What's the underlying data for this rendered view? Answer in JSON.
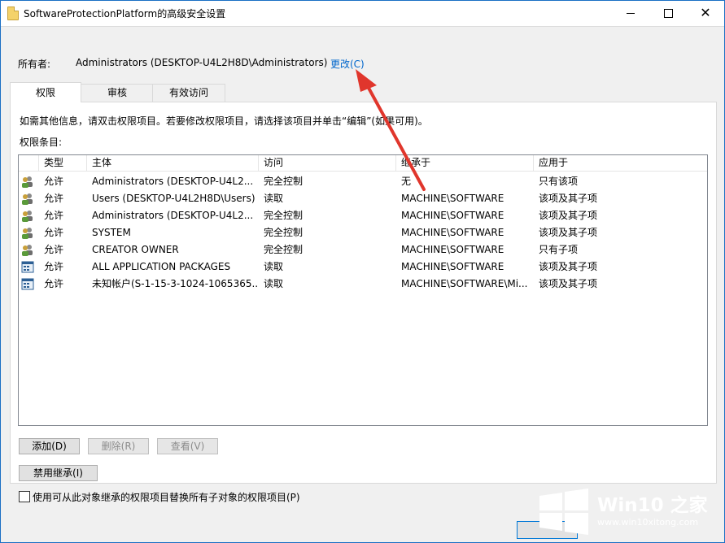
{
  "window": {
    "title": "SoftwareProtectionPlatform的高级安全设置"
  },
  "owner": {
    "label": "所有者:",
    "value": "Administrators (DESKTOP-U4L2H8D\\Administrators)",
    "change_link": "更改(C)"
  },
  "tabs": [
    {
      "label": "权限"
    },
    {
      "label": "审核"
    },
    {
      "label": "有效访问"
    }
  ],
  "info_text": "如需其他信息，请双击权限项目。若要修改权限项目，请选择该项目并单击“编辑”(如果可用)。",
  "entries_label": "权限条目:",
  "columns": [
    "类型",
    "主体",
    "访问",
    "继承于",
    "应用于"
  ],
  "rows": [
    {
      "icon": "users-icon",
      "type": "允许",
      "principal": "Administrators (DESKTOP-U4L2...",
      "access": "完全控制",
      "inherited": "无",
      "applies": "只有该项"
    },
    {
      "icon": "users-icon",
      "type": "允许",
      "principal": "Users (DESKTOP-U4L2H8D\\Users)",
      "access": "读取",
      "inherited": "MACHINE\\SOFTWARE",
      "applies": "该项及其子项"
    },
    {
      "icon": "users-icon",
      "type": "允许",
      "principal": "Administrators (DESKTOP-U4L2...",
      "access": "完全控制",
      "inherited": "MACHINE\\SOFTWARE",
      "applies": "该项及其子项"
    },
    {
      "icon": "users-icon",
      "type": "允许",
      "principal": "SYSTEM",
      "access": "完全控制",
      "inherited": "MACHINE\\SOFTWARE",
      "applies": "该项及其子项"
    },
    {
      "icon": "users-icon",
      "type": "允许",
      "principal": "CREATOR OWNER",
      "access": "完全控制",
      "inherited": "MACHINE\\SOFTWARE",
      "applies": "只有子项"
    },
    {
      "icon": "app-package-icon",
      "type": "允许",
      "principal": "ALL APPLICATION PACKAGES",
      "access": "读取",
      "inherited": "MACHINE\\SOFTWARE",
      "applies": "该项及其子项"
    },
    {
      "icon": "app-package-icon",
      "type": "允许",
      "principal": "未知帐户(S-1-15-3-1024-1065365...",
      "access": "读取",
      "inherited": "MACHINE\\SOFTWARE\\Mi...",
      "applies": "该项及其子项"
    }
  ],
  "buttons": {
    "add": "添加(D)",
    "remove": "删除(R)",
    "view": "查看(V)",
    "disable_inheritance": "禁用继承(I)"
  },
  "replace_checkbox_label": "使用可从此对象继承的权限项目替换所有子对象的权限项目(P)",
  "watermark": {
    "brand": "Win10 之家",
    "url": "www.win10xitong.com"
  },
  "colors": {
    "accent": "#0066cc",
    "arrow": "#e0362c",
    "watermark_bg": "#1c73c9"
  }
}
